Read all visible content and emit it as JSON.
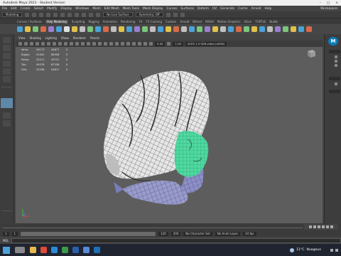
{
  "window": {
    "title": "Autodesk Maya 2023 - Student Version",
    "close_glyph": "×"
  },
  "menubar": {
    "items": [
      "File",
      "Edit",
      "Create",
      "Select",
      "Modify",
      "Display",
      "Windows",
      "Mesh",
      "Edit Mesh",
      "Mesh Tools",
      "Mesh Display",
      "Curves",
      "Surfaces",
      "Deform",
      "UV",
      "Generate",
      "Cache",
      "Arnold",
      "Help"
    ],
    "workspace": "Workspace:"
  },
  "statusline": {
    "mode": "Modeling",
    "no_live_surface": "No Live Surface",
    "symmetry": "Symmetry: Off"
  },
  "shelf_tabs": [
    "Curves / Surfaces",
    "Poly Modeling",
    "Sculpting",
    "Rigging",
    "Animation",
    "Rendering",
    "FX",
    "FX Caching",
    "Custom",
    "Arnold",
    "Bifrost",
    "MASH",
    "Motion Graphics",
    "XGen",
    "TURTLE",
    "Bullet"
  ],
  "shelf_active_tab": "Poly Modeling",
  "shelf_icon_colors": [
    "#4aa3d8",
    "#e0c14a",
    "#7bc67b",
    "#d86a4a",
    "#9a7fd1",
    "#4aa3d8",
    "#e0e0e0",
    "#e0c14a",
    "#c0c0c0",
    "#7bc67b",
    "#4aa3d8",
    "#d86a4a",
    "#c0c0c0",
    "#e0c14a",
    "#4aa3d8",
    "#9a7fd1",
    "#7bc67b",
    "#c0c0c0",
    "#4aa3d8",
    "#e0c14a",
    "#d86a4a",
    "#c0c0c0",
    "#4aa3d8",
    "#7bc67b",
    "#9a7fd1",
    "#e0c14a",
    "#c0c0c0",
    "#4aa3d8",
    "#d86a4a",
    "#7bc67b",
    "#e0c14a",
    "#4aa3d8",
    "#c0c0c0",
    "#9a7fd1",
    "#7bc67b",
    "#e0c14a",
    "#4aa3d8",
    "#d86a4a"
  ],
  "viewport": {
    "menu": [
      "View",
      "Shading",
      "Lighting",
      "Show",
      "Renderer",
      "Panels"
    ],
    "toolbar": {
      "value_a": "0.00",
      "value_b": "1.00",
      "color_space": "ACES 1.0 SDR-video (sRGB)"
    },
    "hud": {
      "rows": [
        {
          "label": "Verts:",
          "a": "26173",
          "b": "44877",
          "c": "0"
        },
        {
          "label": "Edges:",
          "a": "51402",
          "b": "88328",
          "c": "0"
        },
        {
          "label": "Faces:",
          "a": "25211",
          "b": "43721",
          "c": "0"
        },
        {
          "label": "Tris:",
          "a": "49578",
          "b": "87236",
          "c": "0"
        },
        {
          "label": "UVs:",
          "a": "25298",
          "b": "45817",
          "c": "0"
        }
      ]
    }
  },
  "rightbar": {
    "logo": "M"
  },
  "timeslider": {
    "start": "1",
    "end": "120",
    "range_end": "200"
  },
  "rangeslider": {
    "start": "1",
    "mid_start": "1",
    "end": "120",
    "max": "200",
    "character_set": "No Character Set",
    "anim_layer": "No Anim Layer",
    "fps": "24 fps"
  },
  "cmdline": {
    "label": "MEL"
  },
  "taskbar": {
    "app_colors": [
      "#e8b84a",
      "#e04a3a",
      "#2b8ad8",
      "#3a9a4a",
      "#2b5fa8",
      "#5a8ad8",
      "#1e6fb8"
    ],
    "weather_temp": "11°C",
    "weather_desc": "Nuageux"
  }
}
